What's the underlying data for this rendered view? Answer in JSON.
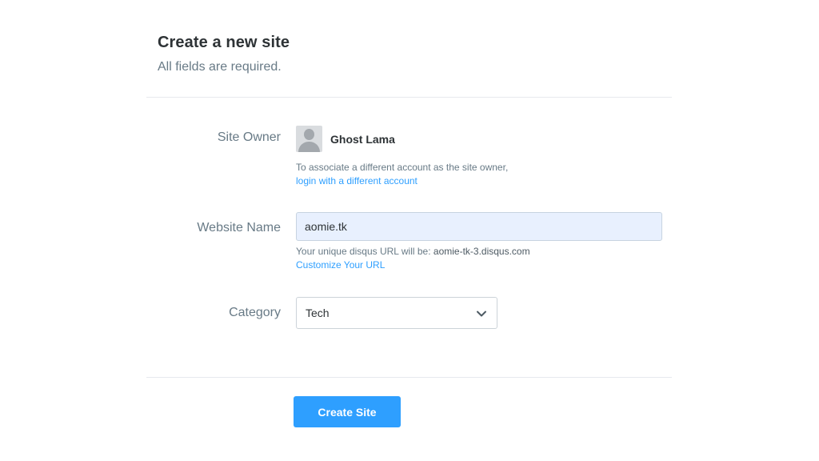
{
  "header": {
    "title": "Create a new site",
    "subtitle": "All fields are required."
  },
  "site_owner": {
    "label": "Site Owner",
    "avatar_icon": "default-user-avatar",
    "name": "Ghost Lama",
    "help_text": "To associate a different account as the site owner,",
    "help_link": "login with a different account"
  },
  "website_name": {
    "label": "Website Name",
    "value": "aomie.tk",
    "help_prefix": "Your unique disqus URL will be: ",
    "help_url": "aomie-tk-3.disqus.com",
    "help_link": "Customize Your URL"
  },
  "category": {
    "label": "Category",
    "selected": "Tech",
    "icon": "chevron-down-icon"
  },
  "actions": {
    "create_label": "Create Site"
  },
  "colors": {
    "accent": "#2e9fff",
    "input_autofill_bg": "#e8f0fe",
    "label_text": "#687a86"
  }
}
